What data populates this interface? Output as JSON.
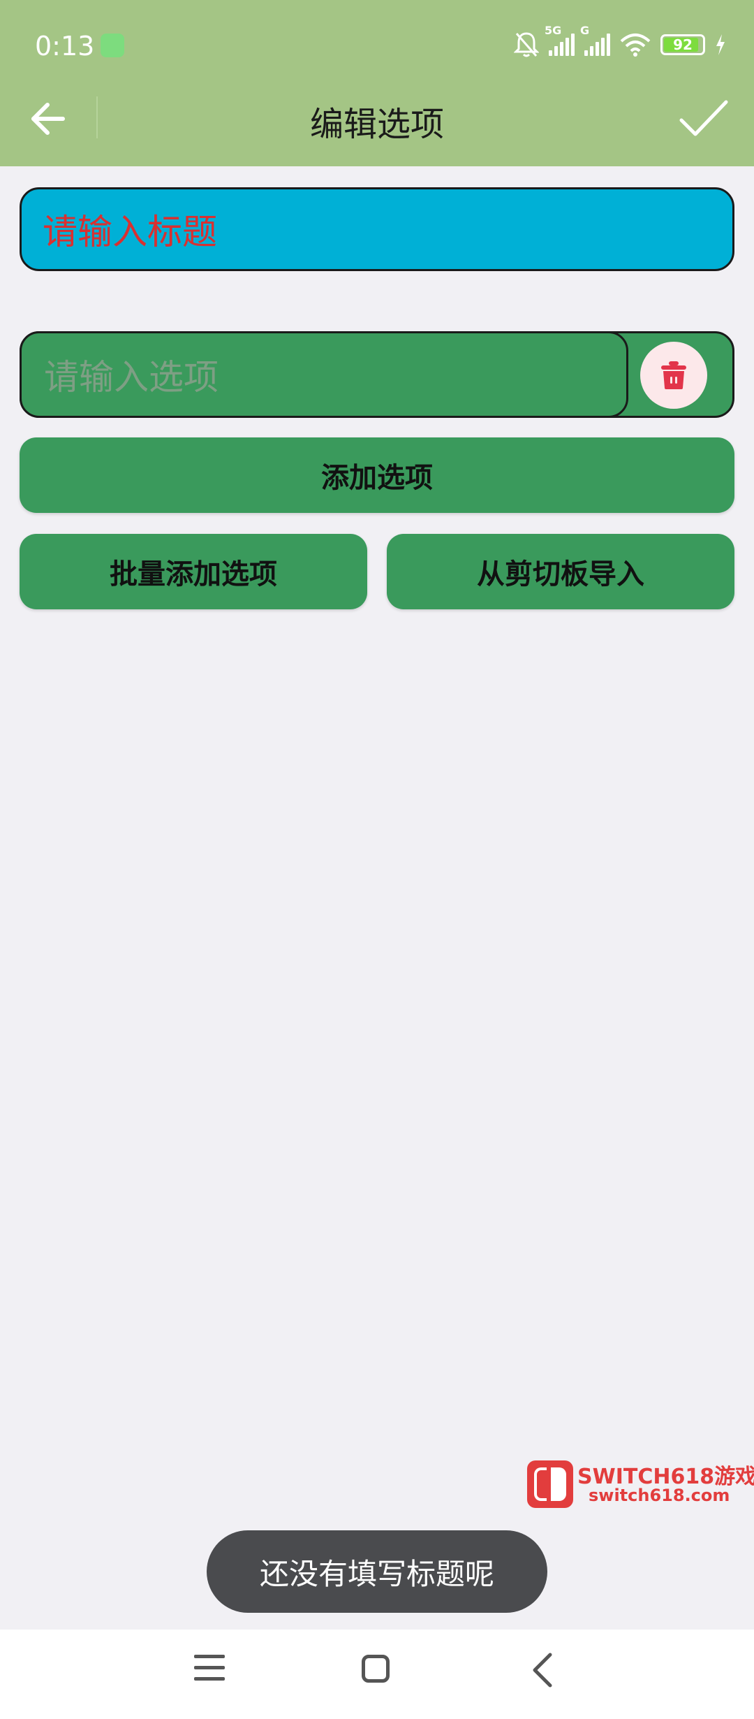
{
  "status_bar": {
    "time": "0:13",
    "signal1_label": "5G",
    "signal2_label": "G",
    "battery_level": "92"
  },
  "header": {
    "title": "编辑选项"
  },
  "title_input": {
    "placeholder": "请输入标题"
  },
  "option_input": {
    "placeholder": "请输入选项"
  },
  "buttons": {
    "add_option": "添加选项",
    "batch_add": "批量添加选项",
    "import_clipboard": "从剪切板导入"
  },
  "watermark": {
    "brand": "SWITCH618游戏",
    "url": "switch618.com"
  },
  "toast": {
    "message": "还没有填写标题呢"
  },
  "colors": {
    "header_bg": "#a4c585",
    "title_input_bg": "#00b0d6",
    "title_placeholder": "#d93030",
    "option_bg": "#3a9a5c",
    "delete_icon": "#e2344a",
    "toast_bg": "#4a4b4e"
  }
}
